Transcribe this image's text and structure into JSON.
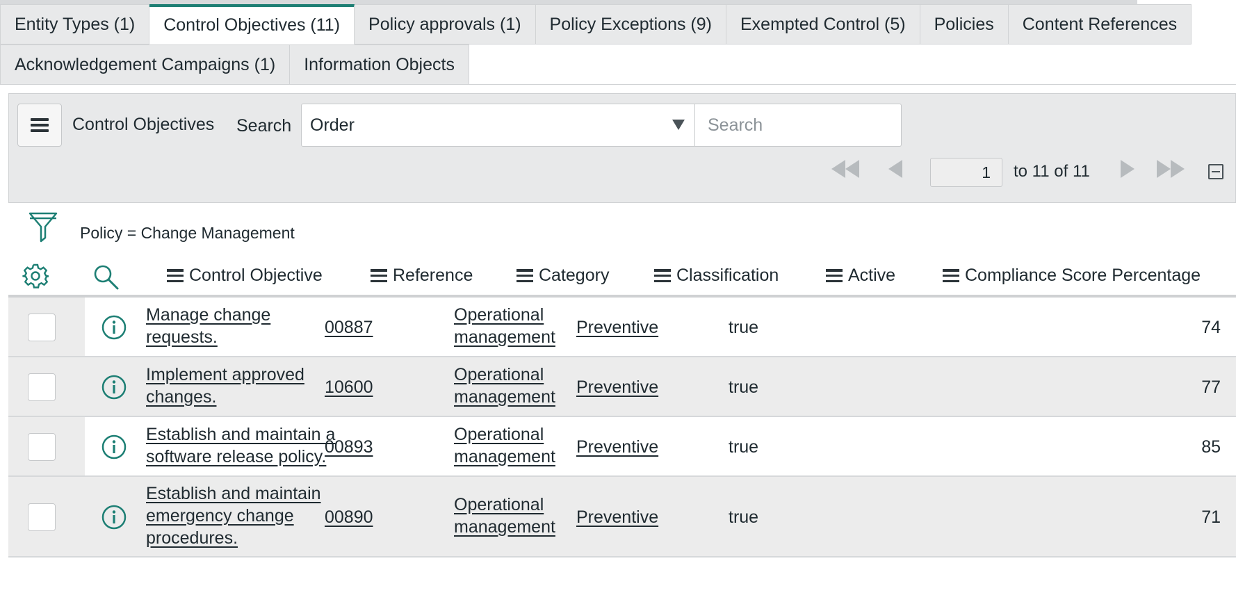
{
  "tabs_row1": [
    {
      "label": "Entity Types (1)",
      "active": false
    },
    {
      "label": "Control Objectives (11)",
      "active": true
    },
    {
      "label": "Policy approvals (1)",
      "active": false
    },
    {
      "label": "Policy Exceptions (9)",
      "active": false
    },
    {
      "label": "Exempted Control (5)",
      "active": false
    },
    {
      "label": "Policies",
      "active": false
    },
    {
      "label": "Content References",
      "active": false
    }
  ],
  "tabs_row2": [
    {
      "label": "Acknowledgement Campaigns (1)",
      "active": false
    },
    {
      "label": "Information Objects",
      "active": false
    }
  ],
  "list": {
    "title": "Control Objectives",
    "search_label": "Search",
    "order_value": "Order",
    "search_placeholder": "Search"
  },
  "pagination": {
    "current": "1",
    "range_text": "to 11 of 11"
  },
  "filter": {
    "text": "Policy = Change Management"
  },
  "columns": {
    "control_objective": "Control Objective",
    "reference": "Reference",
    "category": "Category",
    "classification": "Classification",
    "active": "Active",
    "score": "Compliance Score Percentage"
  },
  "rows": [
    {
      "objective": [
        "Manage change",
        "requests."
      ],
      "reference": "00887",
      "category": [
        "Operational",
        "management"
      ],
      "classification": "Preventive",
      "active": "true",
      "score": "74"
    },
    {
      "objective": [
        "Implement approved",
        "changes."
      ],
      "reference": "10600",
      "category": [
        "Operational",
        "management"
      ],
      "classification": "Preventive",
      "active": "true",
      "score": "77"
    },
    {
      "objective": [
        "Establish and maintain a",
        "software release policy."
      ],
      "reference": "00893",
      "category": [
        "Operational",
        "management"
      ],
      "classification": "Preventive",
      "active": "true",
      "score": "85"
    },
    {
      "objective": [
        "Establish and maintain",
        "emergency change",
        "procedures."
      ],
      "reference": "00890",
      "category": [
        "Operational",
        "management"
      ],
      "classification": "Preventive",
      "active": "true",
      "score": "71"
    }
  ],
  "colors": {
    "accent": "#1d7f74",
    "toolbar_bg": "#e8e9ea",
    "row_alt_bg": "#ececec"
  },
  "icons": {
    "menu": "hamburger-icon",
    "filter": "funnel-icon",
    "settings": "gear-icon",
    "column_search": "magnifier-icon",
    "row_info": "info-circle-icon"
  }
}
